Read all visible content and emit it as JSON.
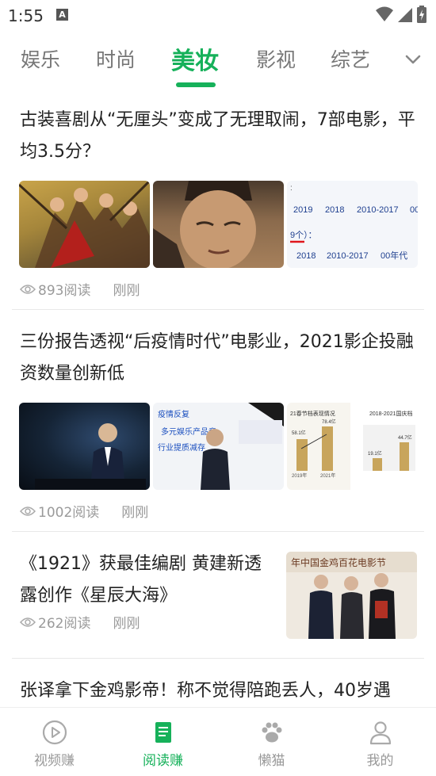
{
  "status_bar": {
    "time": "1:55",
    "notification_icon": "A"
  },
  "tabs": [
    {
      "label": "娱乐"
    },
    {
      "label": "时尚"
    },
    {
      "label": "美妆"
    },
    {
      "label": "影视"
    },
    {
      "label": "综艺"
    }
  ],
  "active_tab": "美妆",
  "articles": [
    {
      "title": "古装喜剧从“无厘头”变成了无理取闹，7部电影，平均3.5分？",
      "views": "893阅读",
      "time": "刚刚",
      "thumb_text": {
        "years_row1": [
          "2019",
          "2018",
          "2010-2017",
          "00"
        ],
        "marked_label": "9个）：",
        "years_row2": [
          "2018",
          "2010-2017",
          "00年代"
        ]
      }
    },
    {
      "title": "三份报告透视“后疫情时代”电影业，2021影企投融资数量创新低",
      "views": "1002阅读",
      "time": "刚刚",
      "thumb_text": {
        "slide_lines": [
          "疫情反复",
          "多元娱乐产品竞",
          "行业提质减存"
        ],
        "chart1_title": "21春节档表现情况",
        "chart1_values": [
          "58.1亿",
          "78.4亿"
        ],
        "chart1_years": [
          "2019年",
          "2021年"
        ],
        "chart2_title": "2018-2021国庆档",
        "chart2_values": [
          "19.1亿",
          "44.7亿"
        ]
      }
    },
    {
      "title": "《1921》获最佳编剧 黄建新透露创作《星辰大海》",
      "views": "262阅读",
      "time": "刚刚",
      "thumb_text": {
        "banner": "年中国金鸡百花电影节"
      }
    },
    {
      "title": "张译拿下金鸡影帝！称不觉得陪跑丢人，40岁遇"
    }
  ],
  "bottom_nav": [
    {
      "label": "视频赚",
      "icon": "play-circle-icon"
    },
    {
      "label": "阅读赚",
      "icon": "document-icon"
    },
    {
      "label": "懒猫",
      "icon": "paw-icon"
    },
    {
      "label": "我的",
      "icon": "person-icon"
    }
  ],
  "colors": {
    "accent": "#16b15a",
    "muted_text": "#9a9a9a",
    "title_text": "#222222"
  }
}
